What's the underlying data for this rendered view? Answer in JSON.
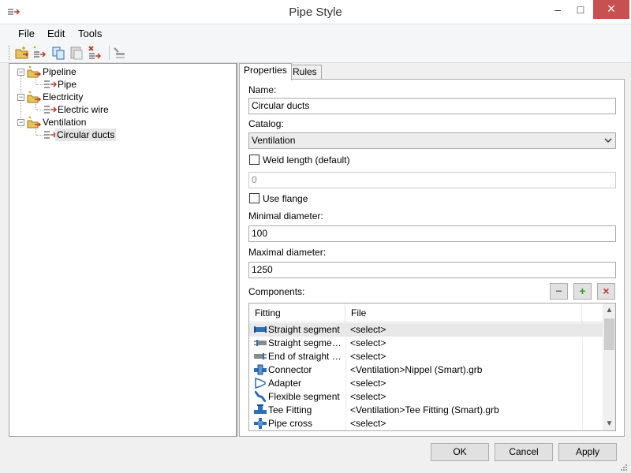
{
  "window": {
    "title": "Pipe Style",
    "minimize_glyph": "–",
    "maximize_glyph": "□",
    "close_glyph": "×"
  },
  "menu": {
    "file": "File",
    "edit": "Edit",
    "tools": "Tools"
  },
  "toolbar": {
    "icons": [
      "new-folder-icon",
      "new-style-icon",
      "copy-icon",
      "paste-icon",
      "delete-icon",
      "properties-icon"
    ]
  },
  "tree": {
    "nodes": [
      {
        "label": "Pipeline",
        "children": [
          {
            "label": "Pipe"
          }
        ]
      },
      {
        "label": "Electricity",
        "children": [
          {
            "label": "Electric wire"
          }
        ]
      },
      {
        "label": "Ventilation",
        "children": [
          {
            "label": "Circular ducts"
          }
        ]
      }
    ],
    "selected": "Circular ducts",
    "collapse_glyph": "−"
  },
  "tabs": {
    "properties": "Properties",
    "rules": "Rules",
    "active": "Properties"
  },
  "form": {
    "name_label": "Name:",
    "name_value": "Circular ducts",
    "catalog_label": "Catalog:",
    "catalog_value": "Ventilation",
    "weld_label": "Weld length (default)",
    "weld_checked": false,
    "weld_value": "0",
    "flange_label": "Use flange",
    "flange_checked": false,
    "min_diameter_label": "Minimal diameter:",
    "min_diameter_value": "100",
    "max_diameter_label": "Maximal diameter:",
    "max_diameter_value": "1250",
    "components_label": "Components:",
    "minus_glyph": "−",
    "plus_glyph": "+",
    "remove_glyph": "×"
  },
  "grid": {
    "columns": [
      "Fitting",
      "File"
    ],
    "rows": [
      {
        "fitting": "Straight segment",
        "file": "<select>",
        "icon": "straight-segment-icon"
      },
      {
        "fitting": "Straight segment ...",
        "file": "<select>",
        "icon": "straight-segment-end-icon"
      },
      {
        "fitting": "End of straight se...",
        "file": "<select>",
        "icon": "end-straight-segment-icon"
      },
      {
        "fitting": "Connector",
        "file": "<Ventilation>Nippel (Smart).grb",
        "icon": "connector-icon"
      },
      {
        "fitting": "Adapter",
        "file": "<select>",
        "icon": "adapter-icon"
      },
      {
        "fitting": "Flexible segment",
        "file": "<select>",
        "icon": "flexible-segment-icon"
      },
      {
        "fitting": "Tee Fitting",
        "file": "<Ventilation>Tee Fitting (Smart).grb",
        "icon": "tee-fitting-icon"
      },
      {
        "fitting": "Pipe cross",
        "file": "<select>",
        "icon": "pipe-cross-icon"
      }
    ],
    "scroll_up_glyph": "▲",
    "scroll_down_glyph": "▼"
  },
  "buttons": {
    "ok": "OK",
    "cancel": "Cancel",
    "apply": "Apply"
  },
  "colors": {
    "accent_red": "#c0392b",
    "close_red": "#c75050",
    "folder_gold": "#d4a017",
    "icon_blue": "#2c6fb7",
    "add_green": "#2e9e2e"
  }
}
